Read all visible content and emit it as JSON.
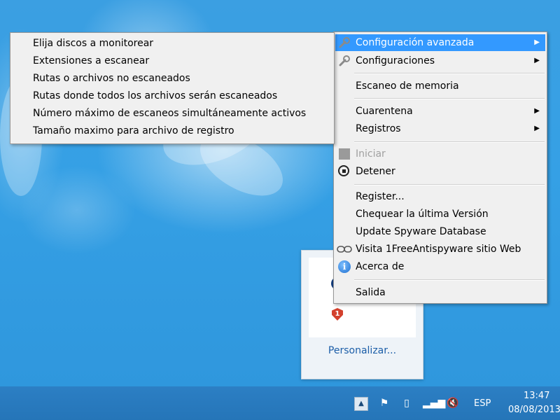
{
  "main_menu": {
    "items": [
      {
        "label": "Configuración avanzada",
        "icon": "wrench-icon",
        "submenu": true
      },
      {
        "label": "Configuraciones",
        "icon": "wrench-icon",
        "submenu": true
      },
      {
        "label": "Escaneo de memoria"
      },
      {
        "label": "Cuarentena",
        "submenu": true
      },
      {
        "label": "Registros",
        "submenu": true
      },
      {
        "label": "Iniciar",
        "icon": "stopped-square-icon",
        "disabled": true
      },
      {
        "label": "Detener",
        "icon": "stop-icon"
      },
      {
        "label": "Register..."
      },
      {
        "label": "Chequear la última Versión"
      },
      {
        "label": "Update Spyware Database"
      },
      {
        "label": "Visita 1FreeAntispyware sitio Web",
        "icon": "link-icon"
      },
      {
        "label": "Acerca de",
        "icon": "info-icon"
      },
      {
        "label": "Salida"
      }
    ]
  },
  "submenu": {
    "items": [
      "Elija discos a monitorear",
      "Extensiones a escanear",
      "Rutas o archivos no escaneados",
      "Rutas donde todos los archivos serán escaneados",
      "Número máximo de escaneos simultáneamente activos",
      "Tamaño maximo para archivo de registro"
    ]
  },
  "tray_panel": {
    "customize_link": "Personalizar...",
    "badge_count": "1"
  },
  "taskbar": {
    "language": "ESP",
    "time": "13:47",
    "date": "08/08/2013"
  },
  "colors": {
    "highlight": "#3399ff",
    "menu_bg": "#f0f0f0",
    "desktop": "#3aa3e6",
    "taskbar": "#2575b8"
  }
}
